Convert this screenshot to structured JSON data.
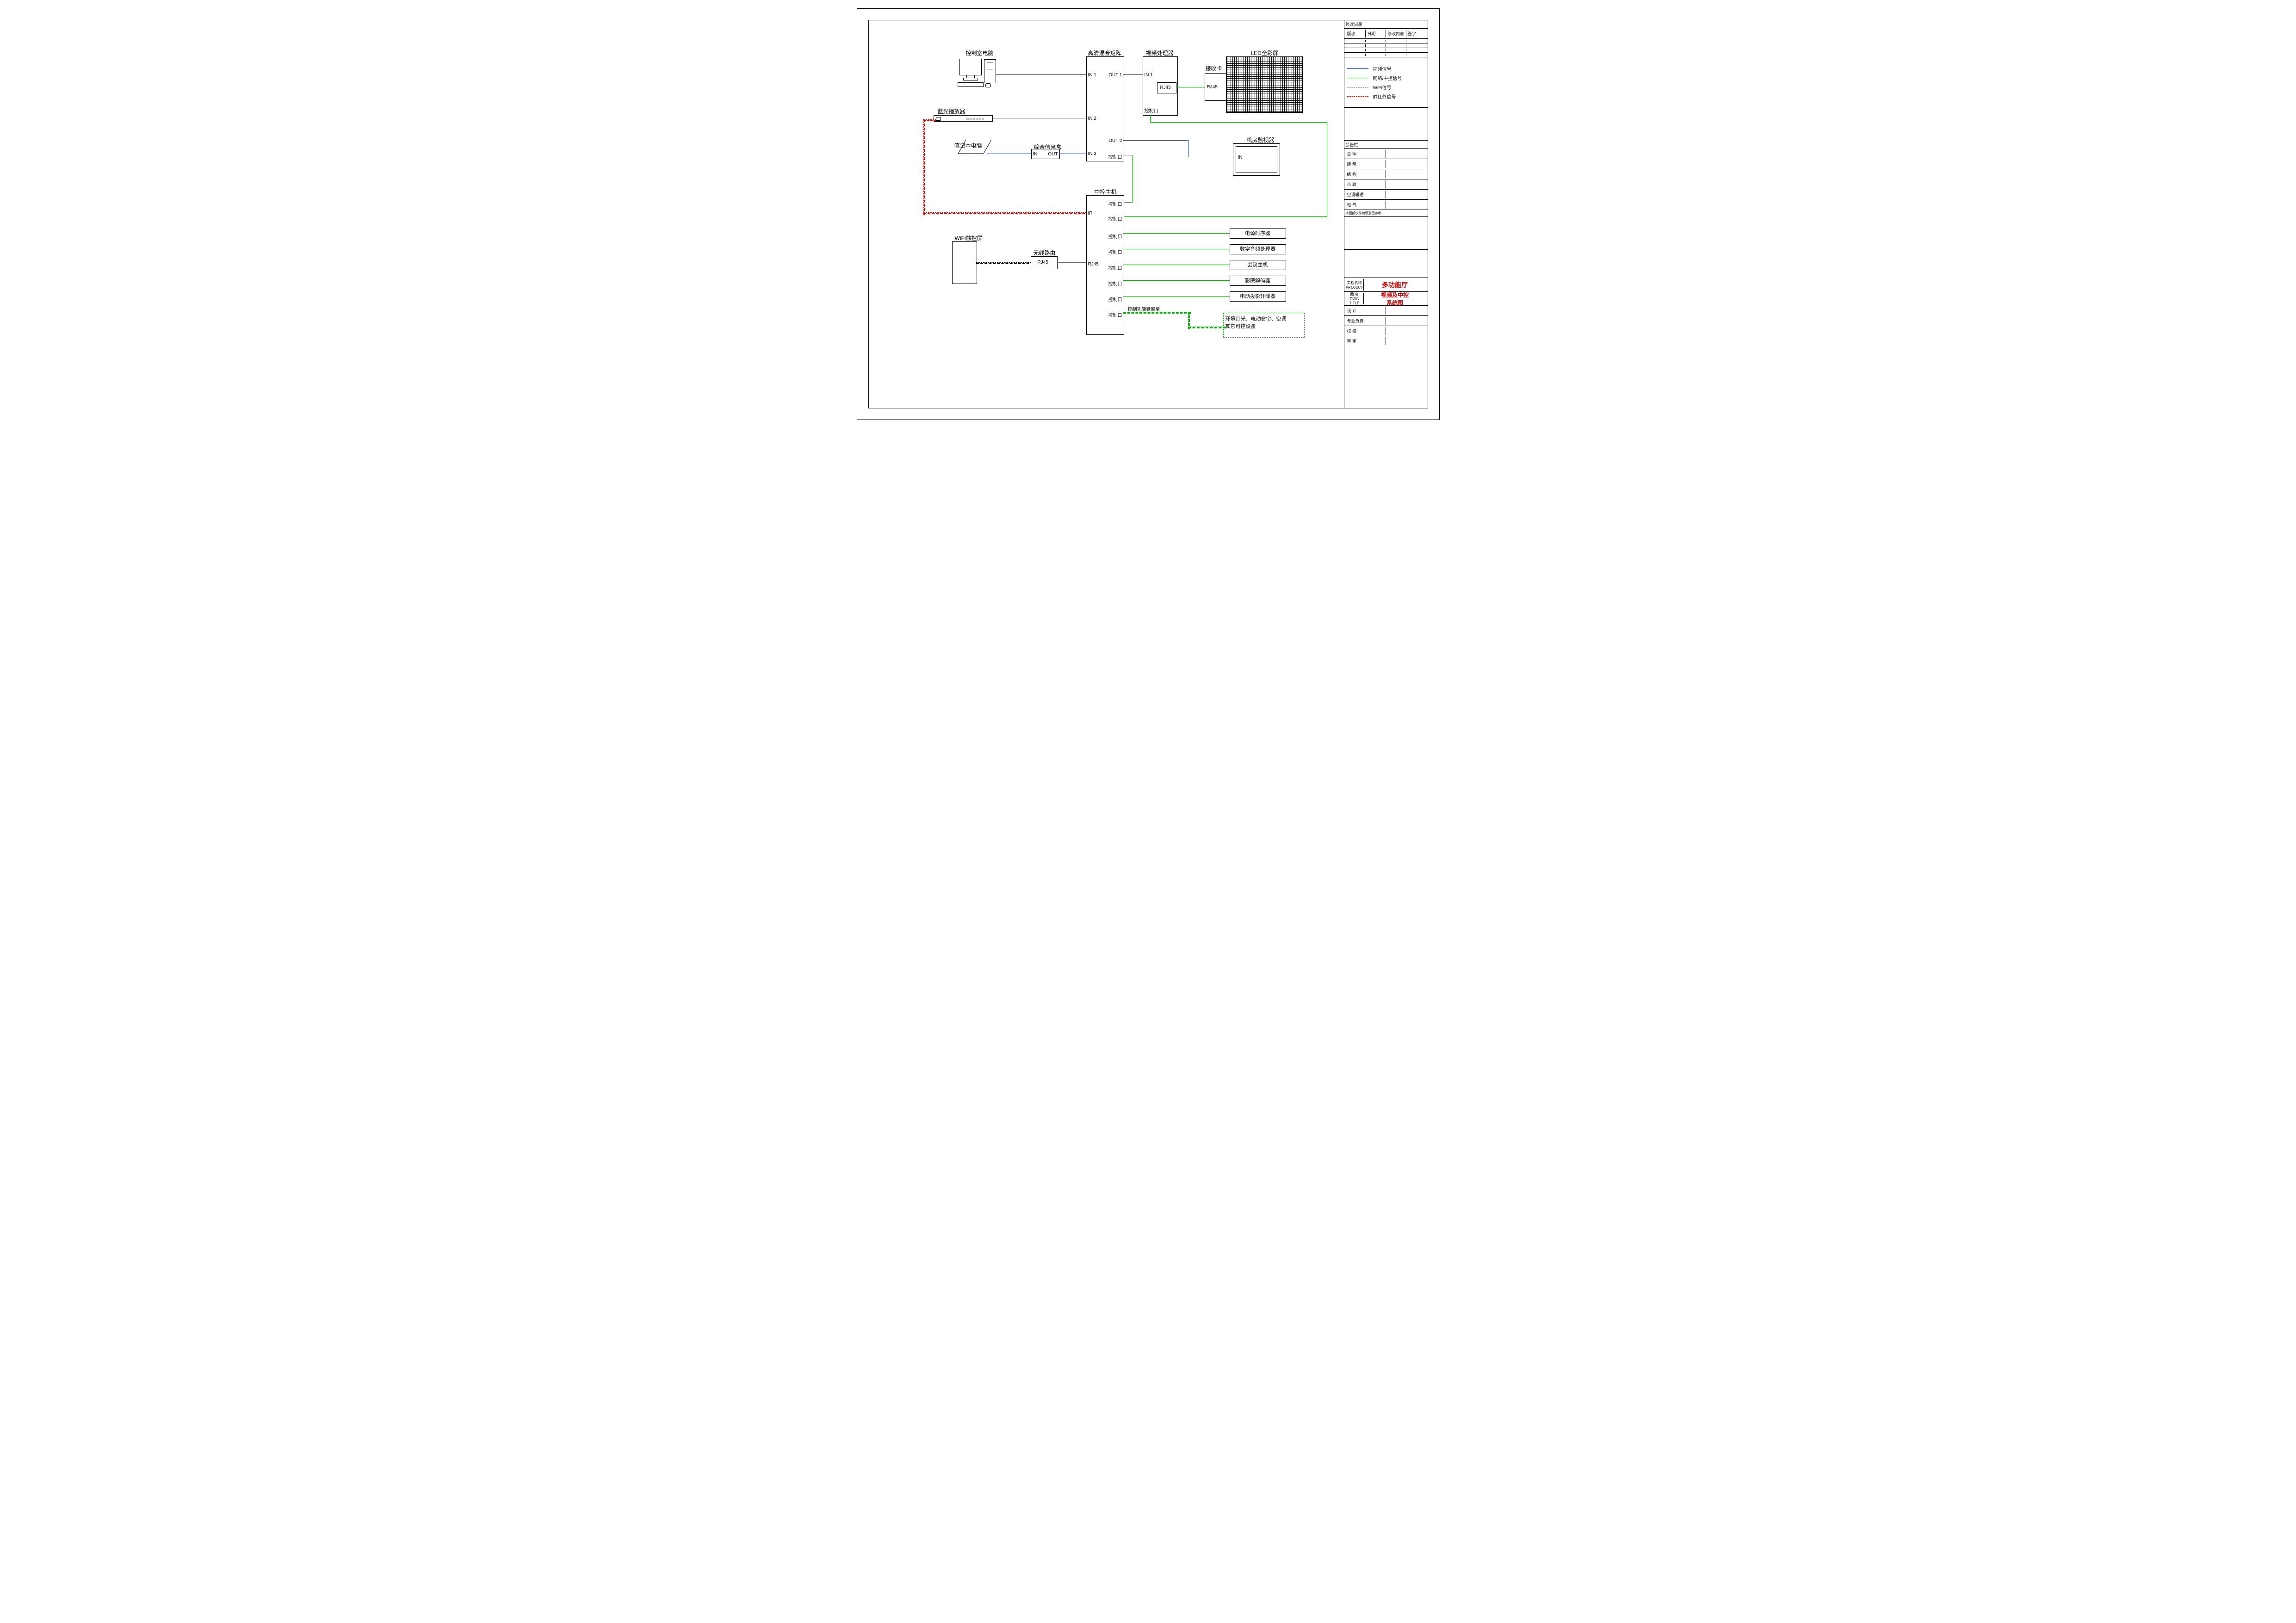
{
  "labels": {
    "control_pc": "控制室电脑",
    "bluray": "蓝光播放器",
    "laptop": "笔记本电脑",
    "infobox": "综合信息盒",
    "matrix": "高清混合矩阵",
    "central": "中控主机",
    "wifi_panel": "WiFi触控屏",
    "router": "无线路由",
    "vproc": "视频处理器",
    "rxcard": "接收卡",
    "ledscreen": "LED全彩屏",
    "monitor": "机房监视器",
    "power_seq": "电源时序器",
    "dsp": "数字音频处理器",
    "conf_host": "会议主机",
    "cinema_dec": "影院解码器",
    "proj_lift": "电动投影升降器",
    "env_note": "环境灯光、电动窗帘、空调\n其它可控设备",
    "ctrl_ext": "控制功能延展至"
  },
  "ports": {
    "in": "IN",
    "out": "OUT",
    "in1": "IN 1",
    "in2": "IN 2",
    "in3": "IN 3",
    "out1": "OUT 1",
    "out2": "OUT 2",
    "ctrl": "控制口",
    "ir": "IR",
    "rj45": "RJ45"
  },
  "legend": {
    "video": "视频信号",
    "net_ctrl": "网络/中控信号",
    "wifi": "WiFi信号",
    "ir": "IR红外信号"
  },
  "title_block": {
    "rev_header": "修改记录",
    "rev_cols": [
      "版次",
      "日期",
      "修改内容",
      "签字"
    ],
    "meeting": "会签栏",
    "rows": [
      "总 体",
      "建 筑",
      "结 构",
      "市 政",
      "空调暖通",
      "电 气"
    ],
    "note_small": "本图纸仅作为示意图参考",
    "project_type_label": "工程名称\nPROJECT",
    "project_type": "多功能厅",
    "drawing_label": "图 名\nDWG TITLE",
    "drawing_name": "视频及中控\n系统图",
    "footer": [
      [
        "设 计",
        ""
      ],
      [
        "专业负责",
        ""
      ],
      [
        "校 核",
        ""
      ],
      [
        "审 定",
        ""
      ]
    ]
  }
}
